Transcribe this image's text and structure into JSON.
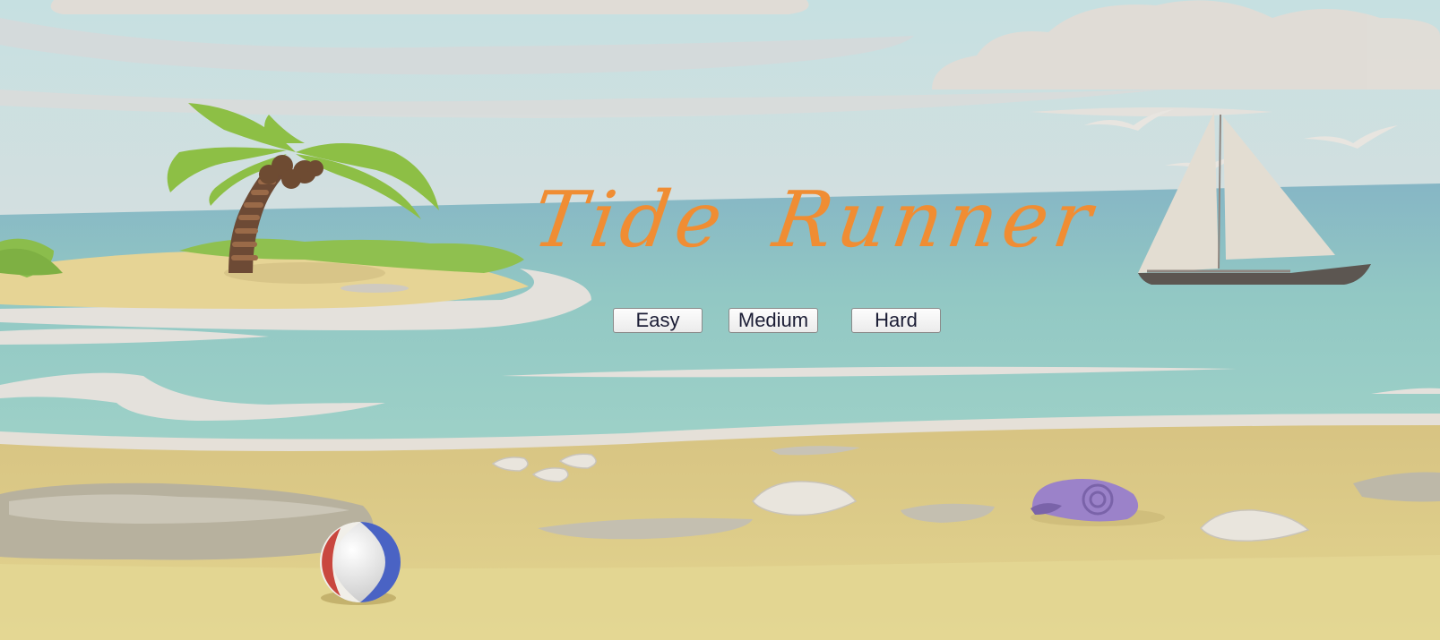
{
  "game": {
    "title": "Tide Runner",
    "difficulty_buttons": {
      "easy": "Easy",
      "medium": "Medium",
      "hard": "Hard"
    }
  },
  "scene": {
    "elements": [
      "sky",
      "clouds",
      "sea",
      "island",
      "palm-tree",
      "sailboat",
      "seagulls",
      "beach",
      "rocks",
      "seashells",
      "spiral-shell",
      "beach-ball"
    ]
  },
  "colors": {
    "title": "#f08d33",
    "sky": "#c9dfdf",
    "sea": "#8fc9c5",
    "sand": "#e3d08a",
    "button_text": "#1b1d35"
  }
}
